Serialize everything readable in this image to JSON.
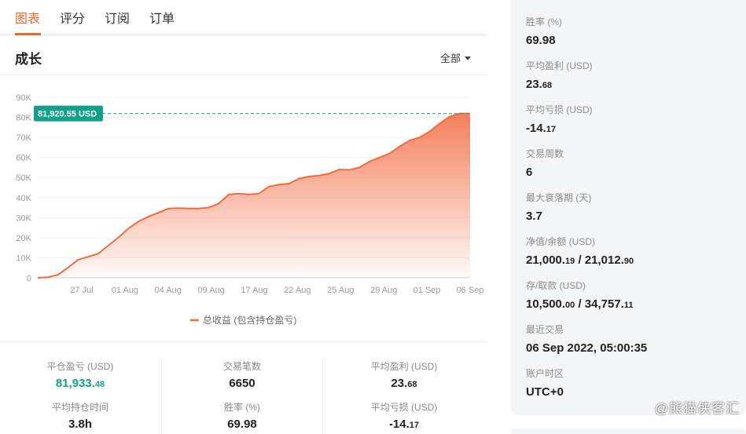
{
  "tabs": [
    {
      "label": "图表",
      "active": true
    },
    {
      "label": "评分",
      "active": false
    },
    {
      "label": "订阅",
      "active": false
    },
    {
      "label": "订单",
      "active": false
    }
  ],
  "section": {
    "title": "成长",
    "range": "全部"
  },
  "chart_data": {
    "type": "area",
    "y_ticks": [
      "0",
      "10K",
      "20K",
      "30K",
      "40K",
      "50K",
      "60K",
      "70K",
      "80K",
      "90K"
    ],
    "ylim": [
      0,
      90000
    ],
    "x_ticks": [
      "27 Jul",
      "01 Aug",
      "04 Aug",
      "09 Aug",
      "17 Aug",
      "22 Aug",
      "25 Aug",
      "29 Aug",
      "01 Sep",
      "06 Sep"
    ],
    "series": [
      {
        "name": "总收益 (包含持仓盈亏)",
        "color": "#f26a3f",
        "values": [
          0,
          300,
          1500,
          5000,
          9000,
          10500,
          12000,
          16000,
          20000,
          24500,
          28000,
          30500,
          32500,
          34500,
          34700,
          34600,
          34500,
          35000,
          37000,
          41500,
          42000,
          41500,
          42000,
          45500,
          46500,
          47000,
          49500,
          50500,
          51000,
          52000,
          54000,
          53800,
          55000,
          58000,
          60000,
          62000,
          65500,
          68500,
          70000,
          73000,
          77000,
          80500,
          81920.55,
          81920.55
        ]
      }
    ],
    "last_value_label": "81,920.55 USD",
    "legend": "bottom-center",
    "grid": true
  },
  "stats": {
    "closed_pnl": {
      "label": "平仓盈亏 (USD)",
      "int": "81,933.",
      "dec": "48"
    },
    "trades": {
      "label": "交易笔数",
      "value": "6650"
    },
    "avg_profit": {
      "label": "平均盈利 (USD)",
      "int": "23.",
      "dec": "68"
    },
    "avg_hold": {
      "label": "平均持仓时间",
      "value": "3.8h"
    },
    "win_rate": {
      "label": "胜率 (%)",
      "value": "69.98"
    },
    "avg_loss": {
      "label": "平均亏损 (USD)",
      "int": "-14.",
      "dec": "17"
    }
  },
  "side": {
    "win_rate": {
      "label": "胜率 (%)",
      "value": "69.98"
    },
    "avg_profit": {
      "label": "平均盈利 (USD)",
      "int": "23.",
      "dec": "68"
    },
    "avg_loss": {
      "label": "平均亏损 (USD)",
      "int": "-14.",
      "dec": "17"
    },
    "weeks": {
      "label": "交易周数",
      "value": "6"
    },
    "drawdown": {
      "label": "最大衰落期 (天)",
      "value": "3.7"
    },
    "equity": {
      "label": "净值/余额 (USD)",
      "a_int": "21,000.",
      "a_dec": "19",
      "sep": " / ",
      "b_int": "21,012.",
      "b_dec": "90"
    },
    "deposits": {
      "label": "存/取款 (USD)",
      "a_int": "10,500.",
      "a_dec": "00",
      "sep": " / ",
      "b_int": "34,757.",
      "b_dec": "11"
    },
    "last_trade": {
      "label": "最近交易",
      "value": "06 Sep 2022, 05:00:35"
    },
    "timezone": {
      "label": "账户时区",
      "value": "UTC+0"
    }
  },
  "watermark": "@熊猫侠客汇"
}
